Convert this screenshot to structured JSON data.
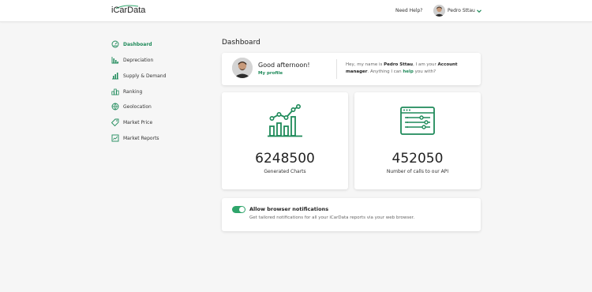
{
  "header": {
    "logo_text": "iCarData",
    "help_label": "Need Help?",
    "user_name": "Pedro Sttau"
  },
  "sidebar": {
    "items": [
      {
        "label": "Dashboard",
        "icon": "dashboard-icon",
        "active": true
      },
      {
        "label": "Depreciation",
        "icon": "depreciation-icon",
        "active": false
      },
      {
        "label": "Supply & Demand",
        "icon": "supply-demand-icon",
        "active": false
      },
      {
        "label": "Ranking",
        "icon": "ranking-icon",
        "active": false
      },
      {
        "label": "Geolocation",
        "icon": "geolocation-icon",
        "active": false
      },
      {
        "label": "Market Price",
        "icon": "price-tag-icon",
        "active": false
      },
      {
        "label": "Market Reports",
        "icon": "report-icon",
        "active": false
      }
    ]
  },
  "main": {
    "title": "Dashboard",
    "greeting": {
      "title": "Good afternoon!",
      "profile_link": "My profile",
      "msg_intro": "Hey, my name is ",
      "msg_name": "Pedro Sttau",
      "msg_mid": ", I am your ",
      "msg_role": "Account manager",
      "msg_line2_start": ". Anything I can ",
      "msg_help": "help",
      "msg_end": " you with?"
    },
    "stats": [
      {
        "value": "6248500",
        "label": "Generated Charts",
        "icon": "bar-line-chart-icon"
      },
      {
        "value": "452050",
        "label": "Number of calls to our API",
        "icon": "api-window-icon"
      }
    ],
    "notifications": {
      "title": "Allow browser notifications",
      "description": "Get tailored notifications for all your iCarData reports via your web browser.",
      "enabled": true
    }
  },
  "colors": {
    "accent": "#1f8a5a",
    "toggle": "#2fa56b",
    "background": "#f6f6f6"
  }
}
